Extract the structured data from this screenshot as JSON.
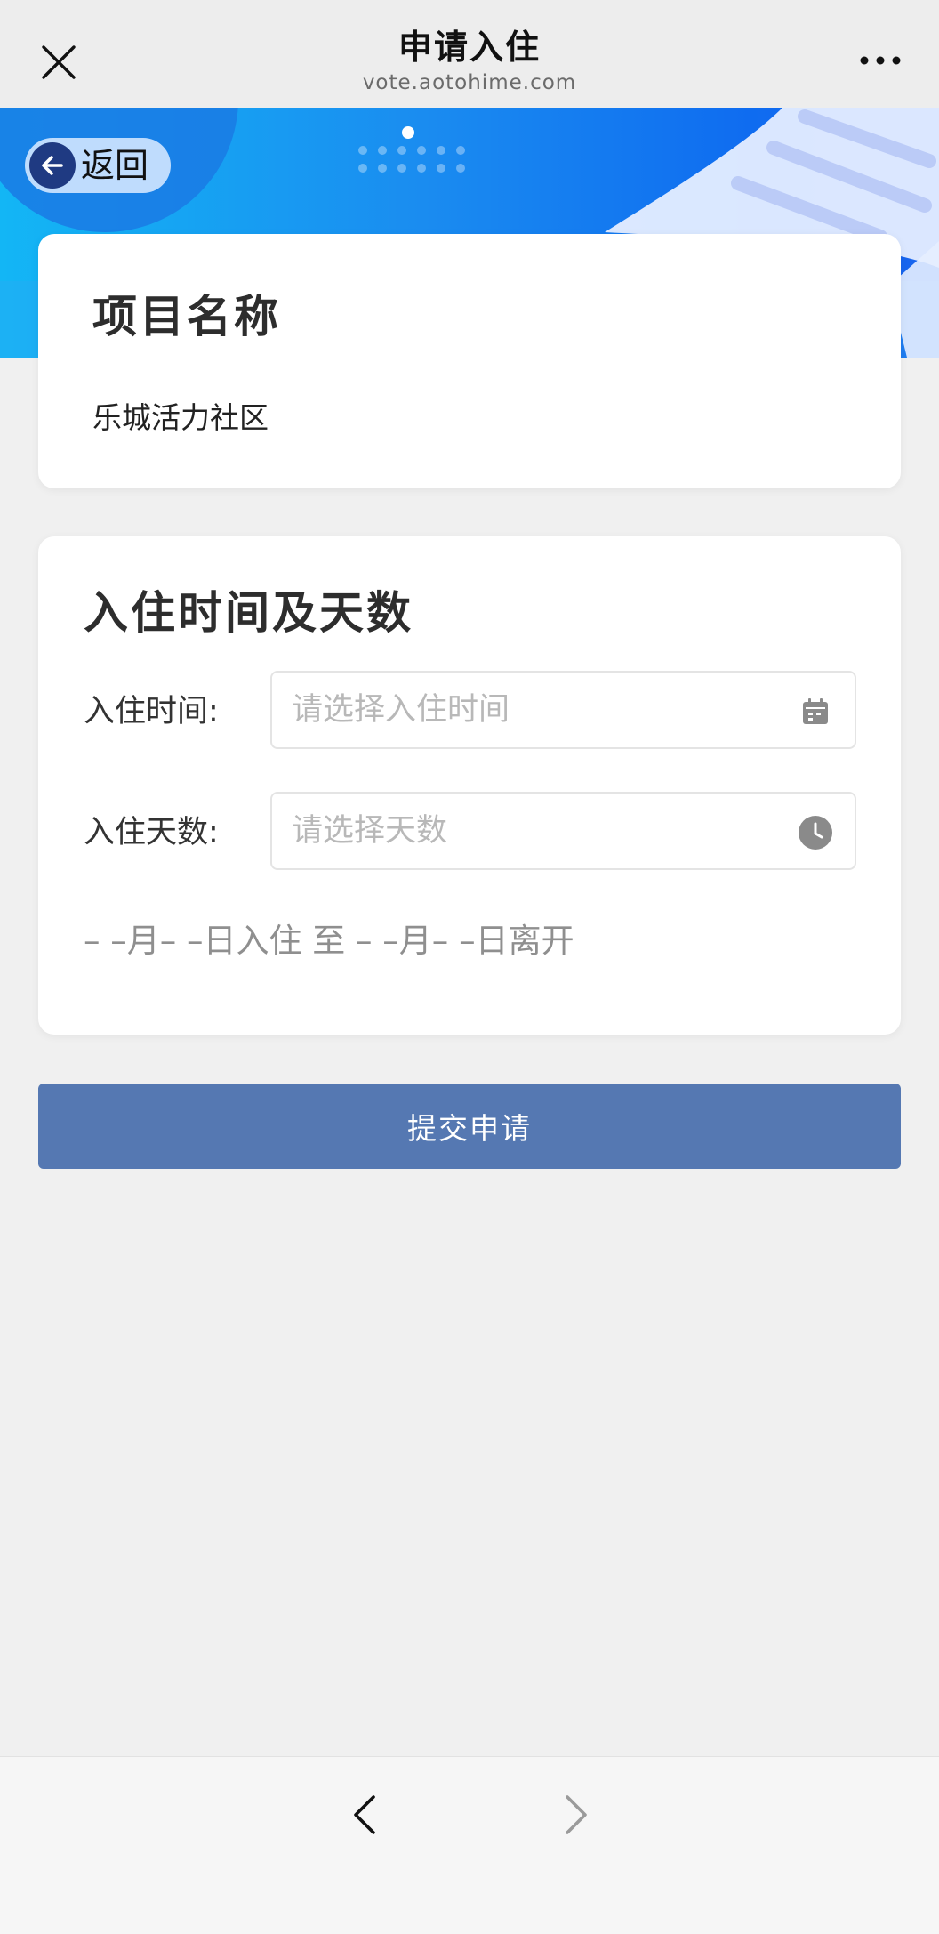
{
  "navbar": {
    "title": "申请入住",
    "url": "vote.aotohime.com"
  },
  "back_button": {
    "label": "返回"
  },
  "project_card": {
    "heading": "项目名称",
    "value": "乐城活力社区"
  },
  "checkin_card": {
    "heading": "入住时间及天数",
    "time_label": "入住时间:",
    "time_placeholder": "请选择入住时间",
    "days_label": "入住天数:",
    "days_placeholder": "请选择天数",
    "summary": "– –月– –日入住 至 – –月– –日离开"
  },
  "submit": {
    "label": "提交申请"
  },
  "colors": {
    "banner_light": "#13b6f5",
    "banner_dark": "#0f6cf0",
    "submit_bg": "#5578b2",
    "back_circle": "#1f3a82"
  },
  "icons": {
    "close": "close-icon",
    "more": "more-icon",
    "back_arrow": "arrow-left-icon",
    "calendar": "calendar-icon",
    "clock": "clock-icon",
    "nav_back": "chevron-left-icon",
    "nav_forward": "chevron-right-icon"
  }
}
